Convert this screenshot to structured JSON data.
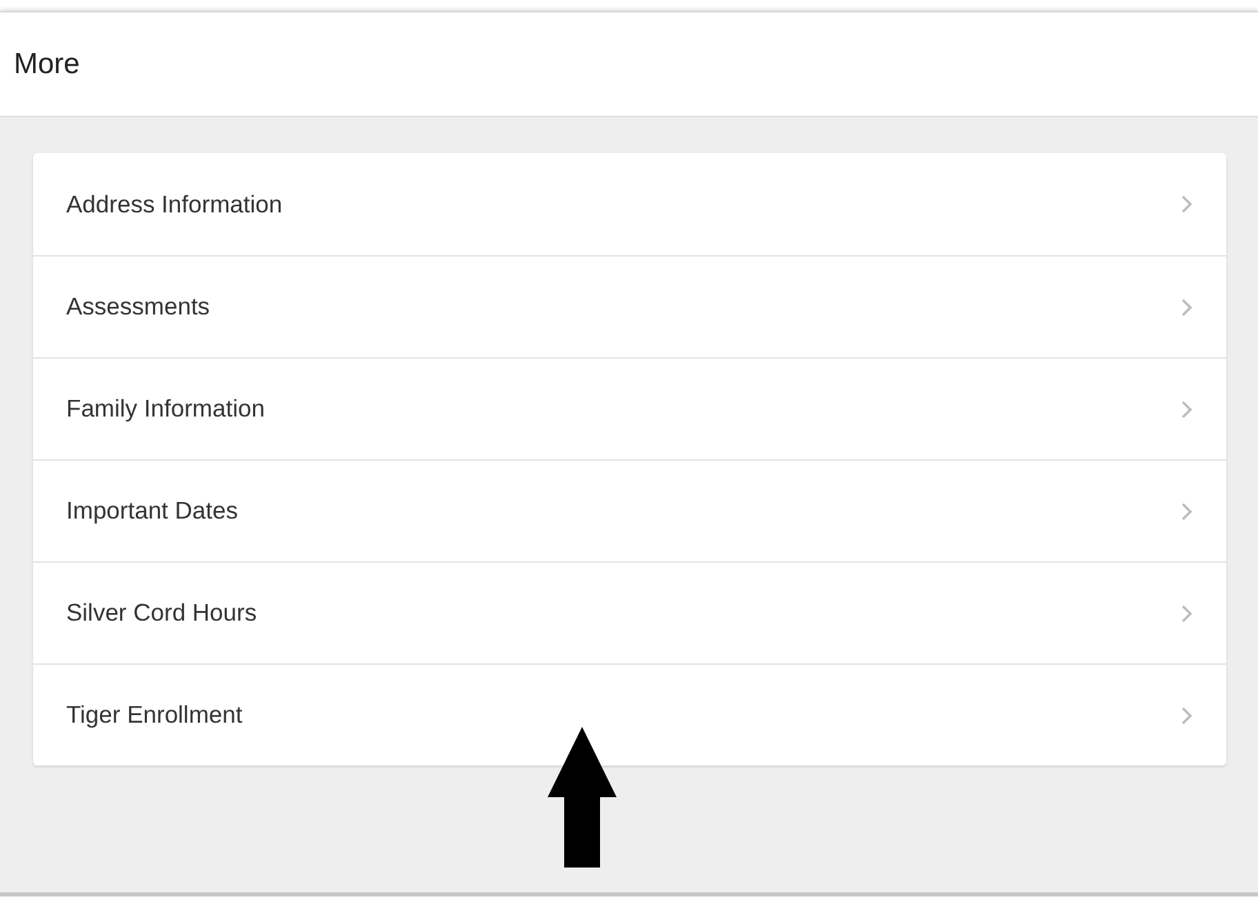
{
  "header": {
    "title": "More"
  },
  "menu_items": [
    {
      "label": "Address Information"
    },
    {
      "label": "Assessments"
    },
    {
      "label": "Family Information"
    },
    {
      "label": "Important Dates"
    },
    {
      "label": "Silver Cord Hours"
    },
    {
      "label": "Tiger Enrollment"
    }
  ]
}
